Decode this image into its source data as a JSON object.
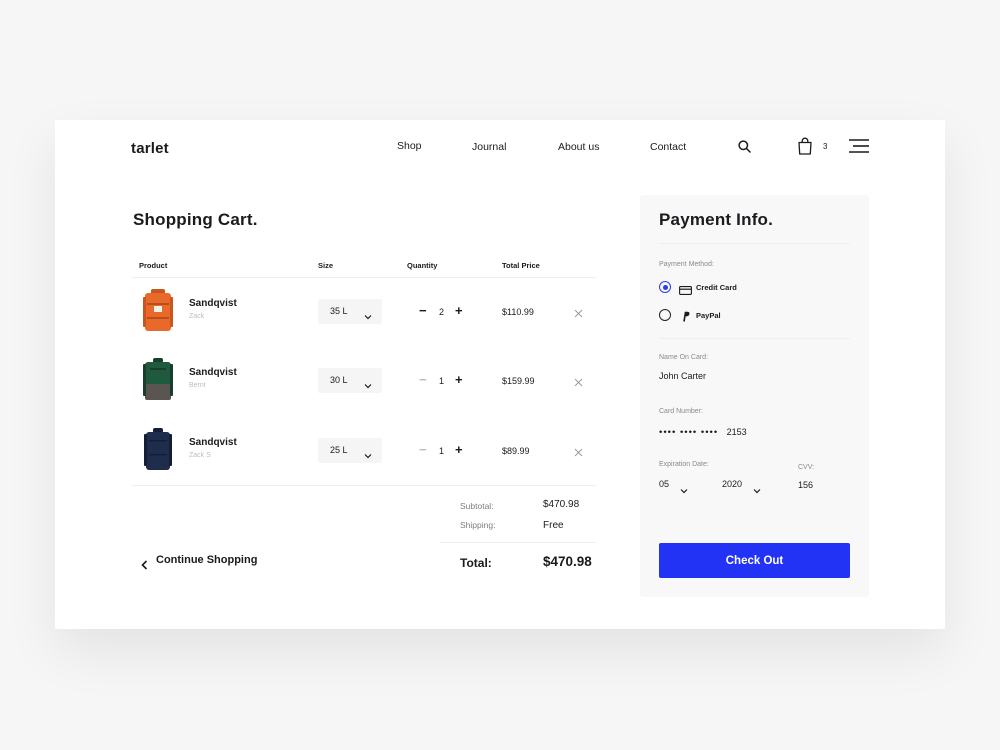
{
  "brand": "tarlet",
  "nav": [
    "Shop",
    "Journal",
    "About us",
    "Contact"
  ],
  "cart_count": "3",
  "cart": {
    "title": "Shopping Cart.",
    "headers": {
      "product": "Product",
      "size": "Size",
      "quantity": "Quantity",
      "total": "Total Price"
    },
    "items": [
      {
        "name": "Sandqvist",
        "variant": "Zack",
        "size": "35 L",
        "qty": "2",
        "price": "$110.99",
        "color": "#e8692a"
      },
      {
        "name": "Sandqvist",
        "variant": "Bernt",
        "size": "30 L",
        "qty": "1",
        "price": "$159.99",
        "color": "#1f5a3f"
      },
      {
        "name": "Sandqvist",
        "variant": "Zack S",
        "size": "25 L",
        "qty": "1",
        "price": "$89.99",
        "color": "#1f2d4d"
      }
    ],
    "subtotal_label": "Subtotal:",
    "subtotal": "$470.98",
    "shipping_label": "Shipping:",
    "shipping": "Free",
    "total_label": "Total:",
    "total": "$470.98",
    "continue": "Continue Shopping"
  },
  "payment": {
    "title": "Payment Info.",
    "method_label": "Payment Method:",
    "methods": [
      "Credit Card",
      "PayPal"
    ],
    "name_label": "Name On Card:",
    "name": "John Carter",
    "number_label": "Card Number:",
    "number_mask": "•••• •••• ••••",
    "number_last": "2153",
    "exp_label": "Expiration Date:",
    "exp_month": "05",
    "exp_year": "2020",
    "cvv_label": "CVV:",
    "cvv": "156",
    "button": "Check Out"
  },
  "colors": {
    "accent": "#2233f5"
  }
}
